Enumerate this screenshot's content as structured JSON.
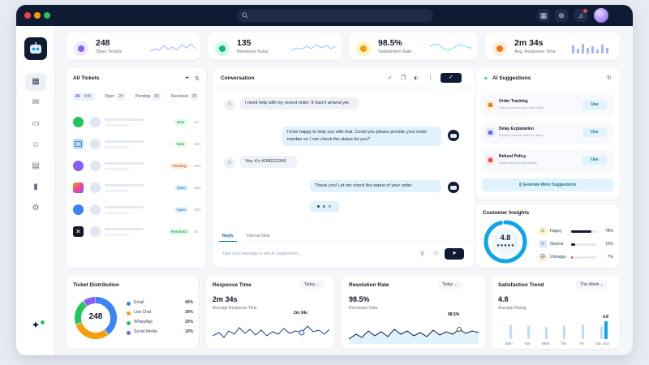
{
  "stats": [
    {
      "value": "248",
      "label": "Open Tickets",
      "icon": "chat-icon",
      "color": "#8b5cf6"
    },
    {
      "value": "135",
      "label": "Resolved Today",
      "icon": "check-chat-icon",
      "color": "#10b981"
    },
    {
      "value": "98.5%",
      "label": "Satisfaction Rate",
      "icon": "smile-icon",
      "color": "#f59e0b"
    },
    {
      "value": "2m 34s",
      "label": "Avg. Response Time",
      "icon": "clock-icon",
      "color": "#f97316"
    }
  ],
  "tickets": {
    "title": "All Tickets",
    "tabs": [
      {
        "label": "All",
        "count": "248"
      },
      {
        "label": "Open",
        "count": "24"
      },
      {
        "label": "Pending",
        "count": "84"
      },
      {
        "label": "Resolved",
        "count": "26"
      }
    ],
    "rows": [
      {
        "channel": "whatsapp-icon",
        "status": "New",
        "time": "2m"
      },
      {
        "channel": "email-icon",
        "status": "New",
        "time": "15m"
      },
      {
        "channel": "messenger-icon",
        "status": "Pending",
        "time": "25m"
      },
      {
        "channel": "instagram-icon",
        "status": "Open",
        "time": "23m"
      },
      {
        "channel": "messenger-icon",
        "status": "Open",
        "time": "30m"
      },
      {
        "channel": "x-icon",
        "status": "Resolved",
        "time": "2h"
      }
    ]
  },
  "conversation": {
    "title": "Conversation",
    "messages": [
      {
        "from": "user",
        "text": "I need help with my recent order. It hasn't arrived yet."
      },
      {
        "from": "bot",
        "text": "I'd be happy to help you with that. Could you please provide your order number so I can check the status for you?"
      },
      {
        "from": "user",
        "text": "Yes, it's #ORD12345"
      },
      {
        "from": "bot",
        "text": "Thank you! Let me check the status of your order."
      }
    ],
    "reply_tabs": [
      "Reply",
      "Internal Note"
    ],
    "input_placeholder": "Type your message or use AI suggestions..."
  },
  "suggestions": {
    "title": "AI Suggestions",
    "items": [
      {
        "title": "Order Tracking",
        "desc": "Help customer track their order",
        "button": "Use",
        "color": "#f97316"
      },
      {
        "title": "Delay Explanation",
        "desc": "Explain possible delivery delay",
        "button": "Use",
        "color": "#6366f1"
      },
      {
        "title": "Refund Policy",
        "desc": "Share refund policy details",
        "button": "Use",
        "color": "#ef4444"
      }
    ],
    "generate_label": "Generate More Suggestions"
  },
  "insights": {
    "title": "Customer Insights",
    "score": "4.8",
    "stars": "★★★★★",
    "rows": [
      {
        "label": "Happy",
        "pct": "78%",
        "value": 0.78,
        "color": "#0f1b33"
      },
      {
        "label": "Neutral",
        "pct": "15%",
        "value": 0.15,
        "color": "#0f1b33"
      },
      {
        "label": "Unhappy",
        "pct": "7%",
        "value": 0.07,
        "color": "#ef4444"
      }
    ]
  },
  "distribution": {
    "title": "Ticket Distribution",
    "total": "248",
    "items": [
      {
        "label": "Email",
        "pct": "40%",
        "value": 40,
        "color": "#3b82f6"
      },
      {
        "label": "Live Chat",
        "pct": "30%",
        "value": 30,
        "color": "#f59e0b"
      },
      {
        "label": "WhatsApp",
        "pct": "20%",
        "value": 20,
        "color": "#22c55e"
      },
      {
        "label": "Social Media",
        "pct": "10%",
        "value": 10,
        "color": "#8b5cf6"
      }
    ]
  },
  "response_time": {
    "title": "Response Time",
    "range": "Today",
    "value": "2m 34s",
    "sub": "Average Response Time",
    "marker": "2m 34s"
  },
  "resolution": {
    "title": "Resolution Rate",
    "range": "Today",
    "value": "98.5%",
    "sub": "Resolution Rate",
    "marker": "98.5%"
  },
  "satisfaction": {
    "title": "Satisfaction Trend",
    "range": "This Week",
    "value": "4.8",
    "sub": "Average Rating",
    "marker": "4.8",
    "days": [
      "Mon",
      "Tue",
      "Wed",
      "Thu",
      "Fri",
      "Sat",
      "Sun"
    ]
  }
}
